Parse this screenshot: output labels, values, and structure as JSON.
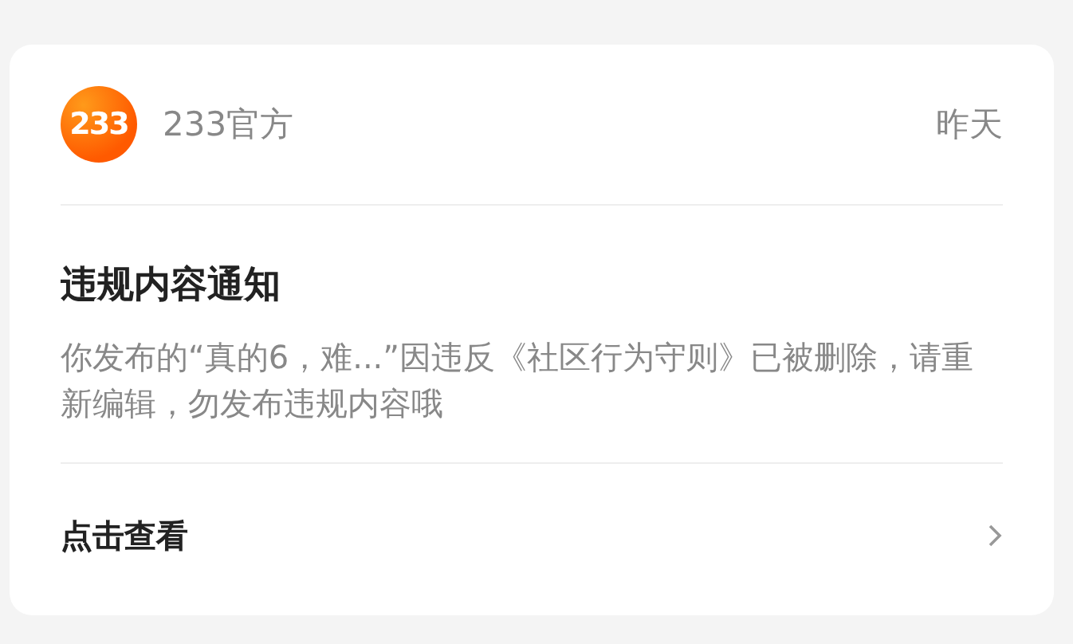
{
  "header": {
    "logo_text": "233",
    "sender": "233官方",
    "time": "昨天"
  },
  "title": "违规内容通知",
  "body": "你发布的“真的6，难...”因违反《社区行为守则》已被删除，请重新编辑，勿发布违规内容哦",
  "action": {
    "label": "点击查看"
  }
}
